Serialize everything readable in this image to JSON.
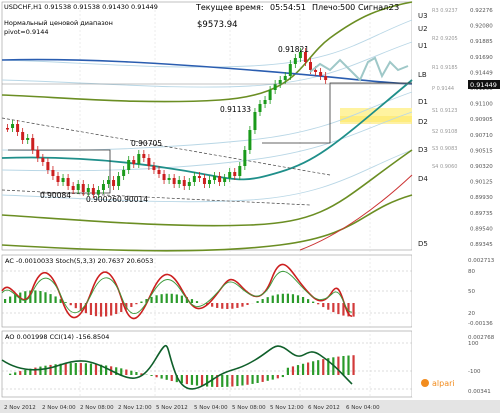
{
  "header": {
    "symbol_line": "USDCHF,H1  0.91538 0.91538 0.91430 0.91449",
    "time_label": "Текущее время:",
    "time_value": "05:54:51",
    "pulse_label": "Плечо:",
    "pulse_value": "500",
    "signal_label": "Сигнал:",
    "signal_value": "23",
    "range_label": "Нормальный ценовой диапазон",
    "pivot_label": "pivot=0.9144",
    "balance": "$9573.94"
  },
  "price_axis": {
    "ticks": [
      "0.92276",
      "0.92080",
      "0.91885",
      "0.91690",
      "0.91449",
      "0.91295",
      "0.91100",
      "0.90905",
      "0.90710",
      "0.90515",
      "0.90320",
      "0.90125",
      "0.89930",
      "0.89735",
      "0.89540",
      "0.89345"
    ],
    "current_price": "0.91449"
  },
  "level_labels": {
    "u3": "U3",
    "u2": "U2",
    "u1": "U1",
    "lb": "LB",
    "d1": "D1",
    "d2": "D2",
    "d3": "D3",
    "d4": "D4",
    "d5": "D5",
    "r3": "R3 0.9237",
    "r2": "R2 0.9205",
    "r1": "R1 0.9185",
    "p": "P 0.9144",
    "s1": "S1 0.9123",
    "s2": "S2 0.9108",
    "s3": "S3 0.9083",
    "s4": "S4 0.9060"
  },
  "annotations": {
    "high1": "0.91821",
    "mid1": "0.91133",
    "mid2": "0.90705",
    "low1": "0.90084",
    "low2": "0.90026",
    "low3": "0.90014"
  },
  "stoch_panel": {
    "label": "AC -0.0010033  Stoch(5,3,3) 20.7637 20.6053",
    "ticks": [
      "0.002713",
      "80",
      "50",
      "20",
      "-0.00136"
    ]
  },
  "ao_panel": {
    "label": "AO 0.001998  CCI(14) -156.8504",
    "ticks": [
      "0.002768",
      "100",
      "-100",
      "0.00341"
    ]
  },
  "time_axis": {
    "labels": [
      "2 Nov 2012",
      "2 Nov 04:00",
      "2 Nov 08:00",
      "2 Nov 12:00",
      "5 Nov 2012",
      "5 Nov 04:00",
      "5 Nov 08:00",
      "5 Nov 12:00",
      "6 Nov 2012",
      "6 Nov 04:00"
    ]
  },
  "watermark": "alpari",
  "colors": {
    "up": "#1a9a1a",
    "down": "#cc1f1f",
    "envelope": "#6b8e23",
    "ma_blue": "#2a5db0",
    "ma_teal": "#1f8f8a",
    "zone": "#fff3a0"
  }
}
